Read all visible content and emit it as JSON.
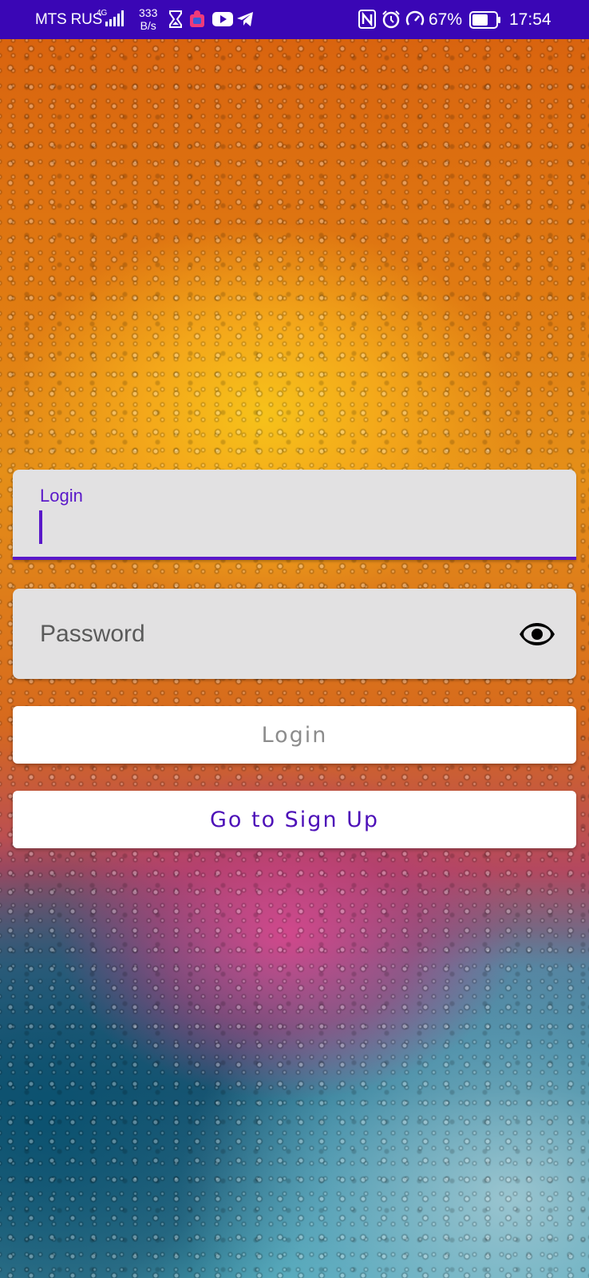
{
  "status_bar": {
    "carrier": "MTS RUS",
    "network_type": "4G",
    "speed_value": "333",
    "speed_unit": "B/s",
    "battery_percent": "67%",
    "time": "17:54",
    "icons": [
      "signal-icon",
      "hourglass-icon",
      "puzzle-icon",
      "youtube-icon",
      "telegram-icon",
      "nfc-icon",
      "alarm-icon",
      "data-saver-icon",
      "battery-icon"
    ]
  },
  "form": {
    "login_label": "Login",
    "login_value": "",
    "password_placeholder": "Password",
    "password_toggle_icon": "eye-icon",
    "login_button_label": "Login",
    "signup_button_label": "Go to Sign Up"
  },
  "colors": {
    "status_bar": "#3a06b5",
    "accent": "#5a18c9",
    "field_bg": "#e2e1e2",
    "button_bg": "#ffffff",
    "disabled_text": "#8c8c8c"
  }
}
